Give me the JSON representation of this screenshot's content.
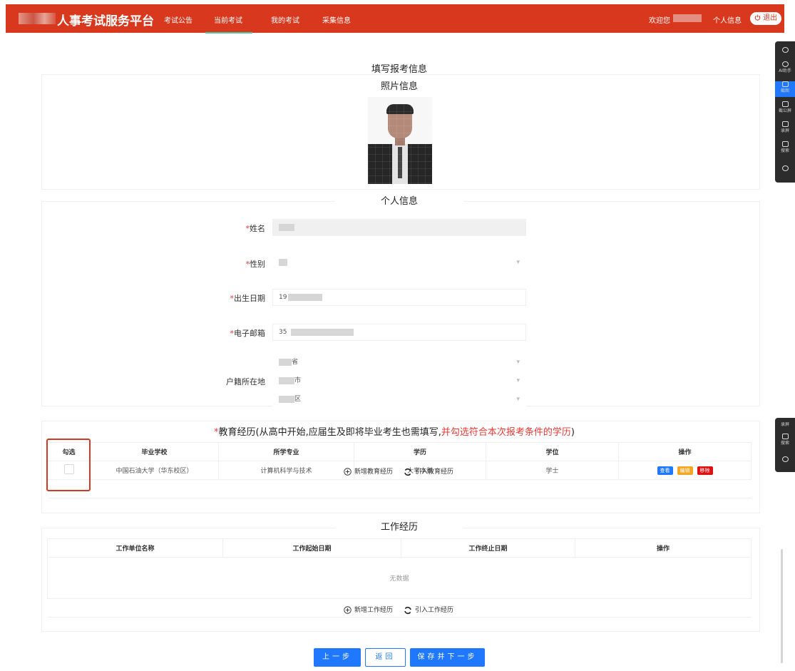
{
  "header": {
    "brand": "人事考试服务平台",
    "nav": [
      "考试公告",
      "当前考试",
      "我的考试",
      "采集信息"
    ],
    "active_nav": "当前考试",
    "welcome": "欢迎您",
    "profile": "个人信息",
    "logout": "退出",
    "accent": "#d7381e"
  },
  "side_panel": {
    "upper": [
      "AI助手",
      "截图",
      "截公屏",
      "录屏",
      "搜索"
    ],
    "lower": [
      "录屏",
      "搜索"
    ]
  },
  "page": {
    "title": "填写报考信息",
    "photo_section": "照片信息",
    "personal_section": "个人信息"
  },
  "personal": {
    "name_label": "姓名",
    "gender_label": "性别",
    "birth_label": "出生日期",
    "birth_value": "19",
    "email_label": "电子邮箱",
    "email_value": "35",
    "hukou_label": "户籍所在地",
    "province_suffix": "省",
    "city_suffix": "市",
    "district_suffix": "区"
  },
  "education": {
    "title_req": "*",
    "title_main": "教育经历(从高中开始,应届生及即将毕业考生也需填写,",
    "title_red": "并勾选符合本次报考条件的学历",
    "title_end": ")",
    "columns": [
      "勾选",
      "毕业学校",
      "所学专业",
      "学历",
      "学位",
      "操作"
    ],
    "rows": [
      {
        "school": "中国石油大学（华东校区）",
        "major": "计算机科学与技术",
        "degree_level": "大学本科",
        "degree": "学士"
      }
    ],
    "actions": [
      "查看",
      "编辑",
      "移除"
    ],
    "add": "新增教育经历",
    "import": "引入教育经历"
  },
  "work": {
    "title": "工作经历",
    "columns": [
      "工作单位名称",
      "工作起始日期",
      "工作终止日期",
      "操作"
    ],
    "empty": "无数据",
    "add": "新增工作经历",
    "import": "引入工作经历"
  },
  "footer": {
    "prev": "上一步",
    "back": "返回",
    "save_next": "保存并下一步"
  },
  "colors": {
    "primary": "#1f78ff",
    "danger": "#e53935",
    "highlight": "#d03a22"
  }
}
